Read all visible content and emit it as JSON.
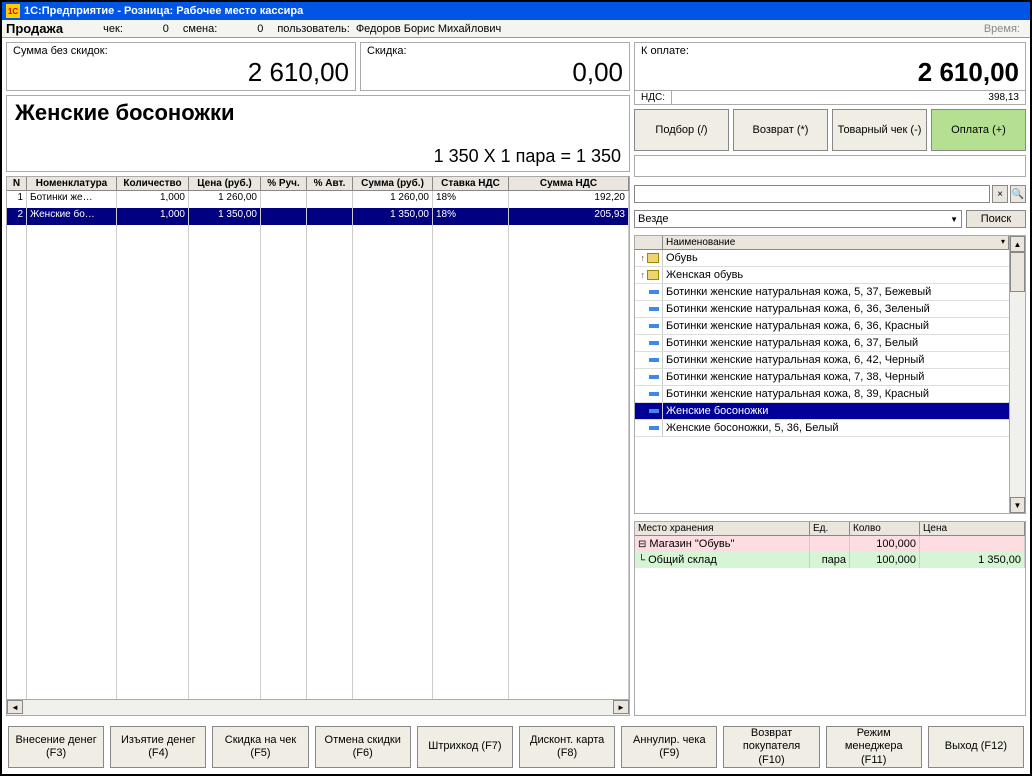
{
  "titlebar": "1С:Предприятие - Розница: Рабочее место кассира",
  "toolbar": {
    "mode": "Продажа",
    "check_label": "чек:",
    "check_value": "0",
    "shift_label": "смена:",
    "shift_value": "0",
    "user_label": "пользователь:",
    "user_value": "Федоров Борис Михайлович",
    "time_label": "Время:"
  },
  "summary": {
    "no_discount_label": "Сумма без скидок:",
    "no_discount_value": "2 610,00",
    "discount_label": "Скидка:",
    "discount_value": "0,00"
  },
  "total": {
    "label": "К оплате:",
    "value": "2 610,00",
    "vat_label": "НДС:",
    "vat_value": "398,13"
  },
  "action_buttons": {
    "select": "Подбор (/)",
    "return": "Возврат (*)",
    "receipt": "Товарный чек (-)",
    "pay": "Оплата (+)"
  },
  "product": {
    "name": "Женские босоножки",
    "calc": "1 350 X 1 пара = 1 350"
  },
  "grid": {
    "headers": [
      "N",
      "Номенклатура",
      "Количество",
      "Цена (руб.)",
      "% Руч.",
      "% Авт.",
      "Сумма (руб.)",
      "Ставка НДС",
      "Сумма НДС"
    ],
    "rows": [
      {
        "n": "1",
        "nom": "Ботинки же…",
        "qty": "1,000",
        "price": "1 260,00",
        "pman": "",
        "pauto": "",
        "sum": "1 260,00",
        "vat": "18%",
        "vatsum": "192,20"
      },
      {
        "n": "2",
        "nom": "Женские бо…",
        "qty": "1,000",
        "price": "1 350,00",
        "pman": "",
        "pauto": "",
        "sum": "1 350,00",
        "vat": "18%",
        "vatsum": "205,93"
      }
    ]
  },
  "search": {
    "combo_value": "Везде",
    "poisk": "Поиск"
  },
  "tree": {
    "header": "Наименование",
    "items": [
      {
        "type": "folder",
        "label": "Обувь",
        "expand": "↑"
      },
      {
        "type": "folder",
        "label": "Женская обувь",
        "expand": "↑"
      },
      {
        "type": "item",
        "label": "Ботинки женские натуральная кожа, 5, 37, Бежевый"
      },
      {
        "type": "item",
        "label": "Ботинки женские натуральная кожа, 6, 36, Зеленый"
      },
      {
        "type": "item",
        "label": "Ботинки женские натуральная кожа, 6, 36, Красный"
      },
      {
        "type": "item",
        "label": "Ботинки женские натуральная кожа, 6, 37, Белый"
      },
      {
        "type": "item",
        "label": "Ботинки женские натуральная кожа, 6, 42, Черный"
      },
      {
        "type": "item",
        "label": "Ботинки женские натуральная кожа, 7, 38, Черный"
      },
      {
        "type": "item",
        "label": "Ботинки женские натуральная кожа, 8, 39, Красный"
      },
      {
        "type": "item",
        "label": "Женские босоножки",
        "selected": true
      },
      {
        "type": "item",
        "label": "Женские босоножки, 5, 36, Белый"
      }
    ]
  },
  "stock": {
    "headers": [
      "Место хранения",
      "Ед.",
      "Колво",
      "Цена"
    ],
    "rows": [
      {
        "icon": "⊟",
        "label": "Магазин \"Обувь\"",
        "unit": "",
        "qty": "100,000",
        "price": "",
        "class": "pink"
      },
      {
        "icon": "└",
        "label": "Общий склад",
        "unit": "пара",
        "qty": "100,000",
        "price": "1 350,00",
        "class": "green"
      }
    ]
  },
  "fkeys": [
    {
      "label": "Внесение денег",
      "key": "(F3)"
    },
    {
      "label": "Изъятие денег",
      "key": "(F4)"
    },
    {
      "label": "Скидка на чек",
      "key": "(F5)"
    },
    {
      "label": "Отмена скидки",
      "key": "(F6)"
    },
    {
      "label": "Штрихкод (F7)",
      "key": ""
    },
    {
      "label": "Дисконт. карта",
      "key": "(F8)"
    },
    {
      "label": "Аннулир. чека",
      "key": "(F9)"
    },
    {
      "label": "Возврат покупателя",
      "key": "(F10)"
    },
    {
      "label": "Режим менеджера",
      "key": "(F11)"
    },
    {
      "label": "Выход (F12)",
      "key": ""
    }
  ]
}
